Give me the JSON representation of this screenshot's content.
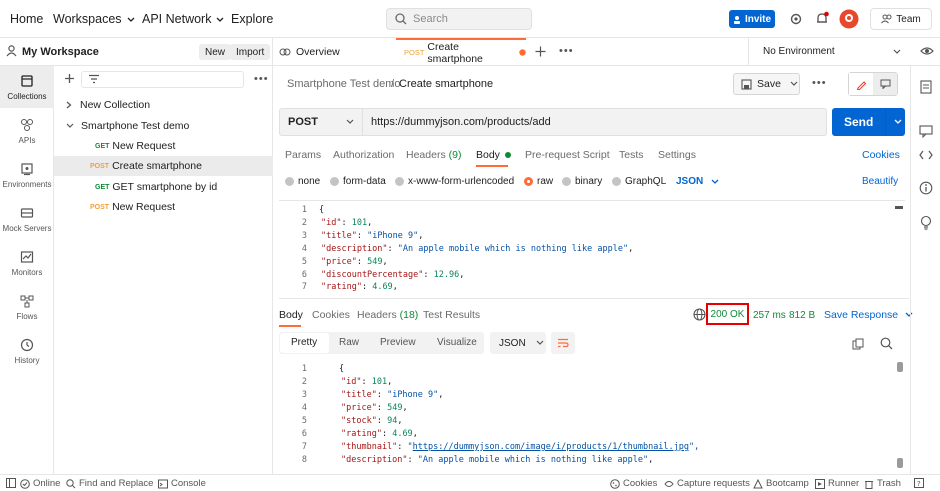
{
  "nav": {
    "home": "Home",
    "workspaces": "Workspaces",
    "api_network": "API Network",
    "explore": "Explore",
    "search_placeholder": "Search",
    "invite": "Invite",
    "team": "Team"
  },
  "workspace": {
    "name": "My Workspace",
    "new_label": "New",
    "import_label": "Import"
  },
  "rail": [
    {
      "label": "Collections",
      "icon": "collections-icon"
    },
    {
      "label": "APIs",
      "icon": "apis-icon"
    },
    {
      "label": "Environments",
      "icon": "environments-icon"
    },
    {
      "label": "Mock Servers",
      "icon": "mock-servers-icon"
    },
    {
      "label": "Monitors",
      "icon": "monitors-icon"
    },
    {
      "label": "Flows",
      "icon": "flows-icon"
    },
    {
      "label": "History",
      "icon": "history-icon"
    }
  ],
  "tree": [
    {
      "label": "New Collection",
      "type": "collection"
    },
    {
      "label": "Smartphone Test demo",
      "type": "collection"
    },
    {
      "label": "New Request",
      "method": "GET"
    },
    {
      "label": "Create smartphone",
      "method": "POST"
    },
    {
      "label": "GET smartphone by id",
      "method": "GET"
    },
    {
      "label": "New Request",
      "method": "POST"
    }
  ],
  "tabs": {
    "overview": "Overview",
    "active_method": "POST",
    "active_name": "Create smartphone",
    "environment": "No Environment"
  },
  "breadcrumb": {
    "collection": "Smartphone Test demo",
    "separator": "/",
    "request": "Create smartphone",
    "save": "Save"
  },
  "request": {
    "method": "POST",
    "url": "https://dummyjson.com/products/add",
    "send": "Send",
    "subtabs": {
      "params": "Params",
      "authorization": "Authorization",
      "headers": "Headers",
      "headers_count": "(9)",
      "body": "Body",
      "prerequest": "Pre-request Script",
      "tests": "Tests",
      "settings": "Settings",
      "cookies": "Cookies"
    },
    "body_types": {
      "none": "none",
      "form_data": "form-data",
      "urlencoded": "x-www-form-urlencoded",
      "raw": "raw",
      "binary": "binary",
      "graphql": "GraphQL",
      "format": "JSON",
      "beautify": "Beautify"
    }
  },
  "request_body": [
    {
      "n": "1",
      "text": "{"
    },
    {
      "n": "2",
      "key": "\"id\"",
      "val": "101",
      "vtype": "n"
    },
    {
      "n": "3",
      "key": "\"title\"",
      "val": "\"iPhone 9\"",
      "vtype": "s"
    },
    {
      "n": "4",
      "key": "\"description\"",
      "val": "\"An apple mobile which is nothing like apple\"",
      "vtype": "s"
    },
    {
      "n": "5",
      "key": "\"price\"",
      "val": "549",
      "vtype": "n"
    },
    {
      "n": "6",
      "key": "\"discountPercentage\"",
      "val": "12.96",
      "vtype": "n"
    },
    {
      "n": "7",
      "key": "\"rating\"",
      "val": "4.69",
      "vtype": "n"
    }
  ],
  "response": {
    "tabs": {
      "body": "Body",
      "cookies": "Cookies",
      "headers": "Headers",
      "headers_count": "(18)",
      "test_results": "Test Results"
    },
    "status": "200 OK",
    "time": "257 ms",
    "size": "812 B",
    "save_response": "Save Response",
    "views": {
      "pretty": "Pretty",
      "raw": "Raw",
      "preview": "Preview",
      "visualize": "Visualize",
      "format": "JSON"
    }
  },
  "response_body": [
    {
      "n": "1",
      "text": "{"
    },
    {
      "n": "2",
      "key": "\"id\"",
      "val": "101",
      "vtype": "n"
    },
    {
      "n": "3",
      "key": "\"title\"",
      "val": "\"iPhone 9\"",
      "vtype": "s"
    },
    {
      "n": "4",
      "key": "\"price\"",
      "val": "549",
      "vtype": "n"
    },
    {
      "n": "5",
      "key": "\"stock\"",
      "val": "94",
      "vtype": "n"
    },
    {
      "n": "6",
      "key": "\"rating\"",
      "val": "4.69",
      "vtype": "n"
    },
    {
      "n": "7",
      "key": "\"thumbnail\"",
      "val": "https://dummyjson.com/image/i/products/1/thumbnail.jpg",
      "vtype": "link"
    },
    {
      "n": "8",
      "key": "\"description\"",
      "val": "\"An apple mobile which is nothing like apple\"",
      "vtype": "s"
    }
  ],
  "statusbar": {
    "online": "Online",
    "find_replace": "Find and Replace",
    "console": "Console",
    "cookies": "Cookies",
    "capture": "Capture requests",
    "bootcamp": "Bootcamp",
    "runner": "Runner",
    "trash": "Trash"
  },
  "colors": {
    "accent": "#ff6c37",
    "primary": "#0265d2",
    "get": "#0f8a3a",
    "post": "#f0a03b",
    "status_ok": "#0f8a3a",
    "highlight_box": "#e60000"
  }
}
